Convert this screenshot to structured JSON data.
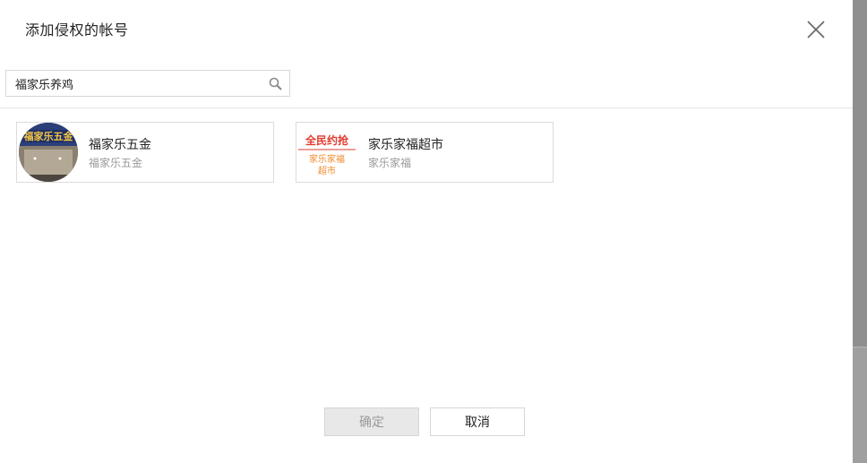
{
  "dialog": {
    "title": "添加侵权的帐号"
  },
  "search": {
    "value": "福家乐养鸡"
  },
  "results": [
    {
      "name": "福家乐五金",
      "subtitle": "福家乐五金",
      "avatar_text": "福家乐五金"
    },
    {
      "name": "家乐家福超市",
      "subtitle": "家乐家福",
      "avatar_line1": "全民约抢",
      "avatar_line2": "家乐家福",
      "avatar_line3": "超市"
    }
  ],
  "footer": {
    "ok_label": "确定",
    "cancel_label": "取消"
  },
  "colors": {
    "accent_red": "#e23a2e",
    "accent_orange": "#f08a2b",
    "disabled_text": "#9a9a9a"
  }
}
